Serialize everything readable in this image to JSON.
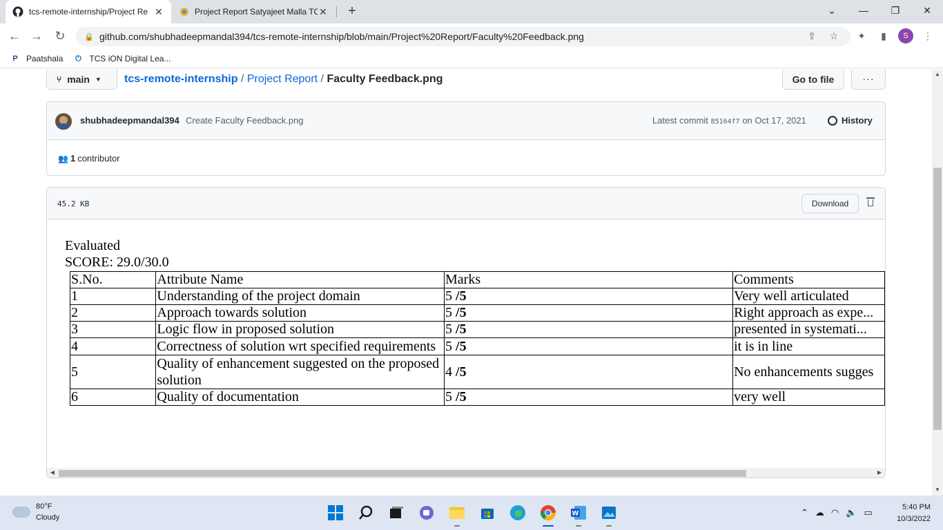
{
  "browser": {
    "tabs": [
      {
        "title": "tcs-remote-internship/Project Re",
        "active": true
      },
      {
        "title": "Project Report Satyajeet Malla TC",
        "active": false
      }
    ],
    "url": "github.com/shubhadeepmandal394/tcs-remote-internship/blob/main/Project%20Report/Faculty%20Feedback.png",
    "profile_initial": "S",
    "bookmarks": [
      {
        "label": "Paatshala",
        "icon_glyph": "P",
        "icon": "paatshala-icon"
      },
      {
        "label": "TCS iON Digital Lea...",
        "icon_glyph": "⏻",
        "icon": "tcs-ion-icon"
      }
    ]
  },
  "github": {
    "branch": "main",
    "breadcrumb": {
      "repo": "tcs-remote-internship",
      "sep1": "/",
      "folder": "Project Report",
      "sep2": "/",
      "file": "Faculty Feedback.png"
    },
    "go_to_file": "Go to file",
    "more_label": "···",
    "commit": {
      "author": "shubhadeepmandal394",
      "message": "Create Faculty Feedback.png",
      "latest_label": "Latest commit",
      "sha": "85164f7",
      "date": "on Oct 17, 2021",
      "history_label": "History"
    },
    "contributors": {
      "count": "1",
      "label": "contributor"
    },
    "file": {
      "size": "45.2 KB",
      "download_label": "Download"
    }
  },
  "image_content": {
    "evaluated": "Evaluated",
    "score": "SCORE: 29.0/30.0",
    "table": {
      "headers": [
        "S.No.",
        "Attribute Name",
        "Marks",
        "Comments"
      ],
      "rows": [
        {
          "sno": "1",
          "attribute": "Understanding of the project domain",
          "mark": "5",
          "out_of": "/5",
          "comment": "Very well articulated"
        },
        {
          "sno": "2",
          "attribute": "Approach towards solution",
          "mark": "5",
          "out_of": "/5",
          "comment": "Right approach as expe..."
        },
        {
          "sno": "3",
          "attribute": "Logic flow in proposed solution",
          "mark": "5",
          "out_of": "/5",
          "comment": "presented in systemati..."
        },
        {
          "sno": "4",
          "attribute": "Correctness of solution wrt specified requirements",
          "mark": "5",
          "out_of": "/5",
          "comment": "it is in line"
        },
        {
          "sno": "5",
          "attribute": "Quality of enhancement suggested on the proposed solution",
          "mark": "4",
          "out_of": "/5",
          "comment": "No enhancements sugges"
        },
        {
          "sno": "6",
          "attribute": "Quality of documentation",
          "mark": "5",
          "out_of": "/5",
          "comment": "very well"
        }
      ]
    }
  },
  "taskbar": {
    "weather": {
      "temp": "80°F",
      "condition": "Cloudy"
    },
    "time": "5:40 PM",
    "date": "10/3/2022"
  }
}
